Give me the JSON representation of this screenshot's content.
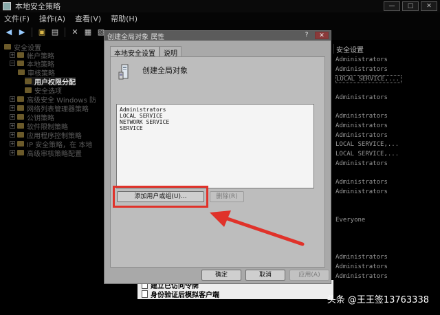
{
  "main_window": {
    "title": "本地安全策略",
    "menu": [
      "文件(F)",
      "操作(A)",
      "查看(V)",
      "帮助(H)"
    ]
  },
  "tree": [
    {
      "label": "安全设置"
    },
    {
      "label": "帐户策略"
    },
    {
      "label": "本地策略"
    },
    {
      "label": "审核策略"
    },
    {
      "label": "用户权限分配"
    },
    {
      "label": "安全选项"
    },
    {
      "label": "高级安全 Windows 防"
    },
    {
      "label": "网络列表管理器策略"
    },
    {
      "label": "公钥策略"
    },
    {
      "label": "软件限制策略"
    },
    {
      "label": "应用程序控制策略"
    },
    {
      "label": "IP 安全策略，在 本地"
    },
    {
      "label": "高级审核策略配置"
    }
  ],
  "list_pane": {
    "header": "安全设置",
    "rows": [
      "Administrators",
      "Administrators",
      "LOCAL SERVICE,...",
      "Administrators",
      "Administrators",
      "Administrators",
      "Administrators",
      "LOCAL SERVICE,...",
      "LOCAL SERVICE,...",
      "Administrators",
      "Administrators",
      "Administrators",
      "Everyone",
      "Administrators",
      "Administrators",
      "Administrators"
    ]
  },
  "bottom_list": {
    "rows": [
      "建立已访问令牌",
      "身份验证后模拟客户端"
    ]
  },
  "dialog": {
    "title": "创建全局对象 属性",
    "help_label": "?",
    "close_label": "✕",
    "tabs": [
      {
        "label": "本地安全设置",
        "active": true
      },
      {
        "label": "说明",
        "active": false
      }
    ],
    "policy_name": "创建全局对象",
    "members": [
      "Administrators",
      "LOCAL SERVICE",
      "NETWORK SERVICE",
      "SERVICE"
    ],
    "add_button": "添加用户或组(U)...",
    "remove_button": "删除(R)",
    "ok_button": "确定",
    "cancel_button": "取消",
    "apply_button": "应用(A)"
  },
  "watermark": "头条 @王王签13763338",
  "colors": {
    "highlight": "#e0322a",
    "dialog_bg": "#a9a9a9"
  }
}
